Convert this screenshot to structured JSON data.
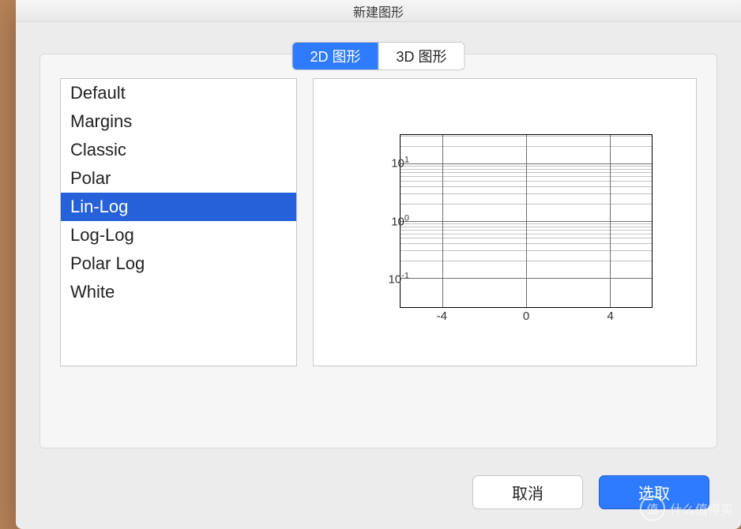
{
  "window": {
    "title": "新建图形"
  },
  "tabs": {
    "tab_2d": "2D 图形",
    "tab_3d": "3D 图形",
    "active_index": 0
  },
  "templates": {
    "items": [
      "Default",
      "Margins",
      "Classic",
      "Polar",
      "Lin-Log",
      "Log-Log",
      "Polar Log",
      "White"
    ],
    "selected_index": 4
  },
  "chart_data": {
    "type": "lin-log-grid",
    "x_ticks": [
      -4,
      0,
      4
    ],
    "y_ticks_exponents": [
      -1,
      0,
      1
    ],
    "y_tick_labels": [
      "10⁻¹",
      "10⁰",
      "10¹"
    ],
    "xlim": [
      -6,
      6
    ],
    "ylim_log10": [
      -1.5,
      1.5
    ],
    "series": []
  },
  "buttons": {
    "cancel": "取消",
    "select": "选取"
  },
  "watermark": {
    "icon_text": "值",
    "label": "什么值得买"
  }
}
